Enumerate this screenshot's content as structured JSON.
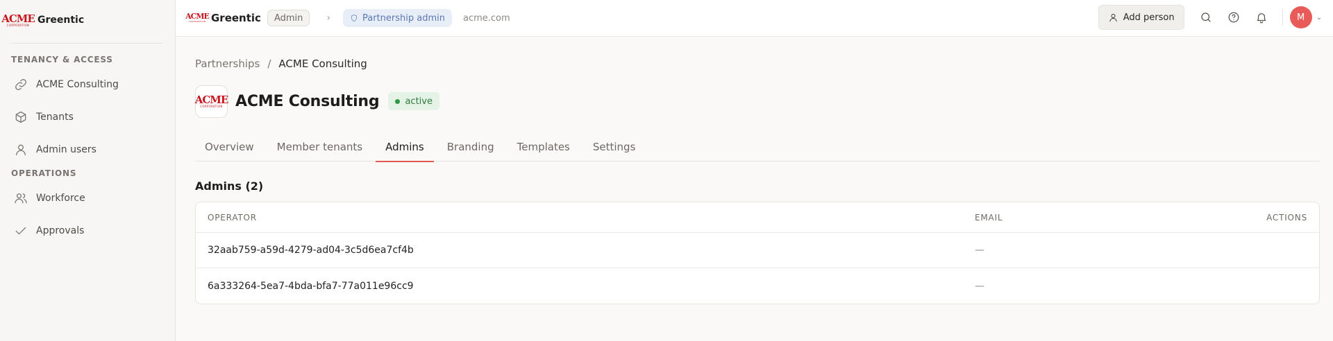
{
  "sidebar": {
    "brand": {
      "logo_text": "ACME",
      "logo_subtext": "CORPORATION",
      "name": "Greentic"
    },
    "sections": [
      {
        "label": "TENANCY & ACCESS",
        "items": [
          {
            "label": "ACME Consulting",
            "icon": "link-icon"
          },
          {
            "label": "Tenants",
            "icon": "cube-icon"
          },
          {
            "label": "Admin users",
            "icon": "user-icon"
          }
        ]
      },
      {
        "label": "OPERATIONS",
        "items": [
          {
            "label": "Workforce",
            "icon": "users-icon"
          },
          {
            "label": "Approvals",
            "icon": "check-icon"
          }
        ]
      }
    ]
  },
  "topbar": {
    "brand_name": "Greentic",
    "admin_chip": "Admin",
    "partnership_chip": "Partnership admin",
    "domain": "acme.com",
    "add_person_label": "Add person",
    "avatar_initial": "M"
  },
  "breadcrumb": {
    "parent": "Partnerships",
    "separator": "/",
    "current": "ACME Consulting"
  },
  "header": {
    "title": "ACME Consulting",
    "status": "active"
  },
  "tabs": [
    {
      "label": "Overview",
      "active": false
    },
    {
      "label": "Member tenants",
      "active": false
    },
    {
      "label": "Admins",
      "active": true
    },
    {
      "label": "Branding",
      "active": false
    },
    {
      "label": "Templates",
      "active": false
    },
    {
      "label": "Settings",
      "active": false
    }
  ],
  "admins": {
    "title": "Admins (2)",
    "columns": {
      "operator": "OPERATOR",
      "email": "EMAIL",
      "actions": "ACTIONS"
    },
    "rows": [
      {
        "operator": "32aab759-a59d-4279-ad04-3c5d6ea7cf4b",
        "email": "—"
      },
      {
        "operator": "6a333264-5ea7-4bda-bfa7-77a011e96cc9",
        "email": "—"
      }
    ]
  },
  "colors": {
    "accent": "#e05a52",
    "status_green": "#2f9a45",
    "partner_blue": "#5b78b0",
    "brand_red": "#c8161d"
  }
}
